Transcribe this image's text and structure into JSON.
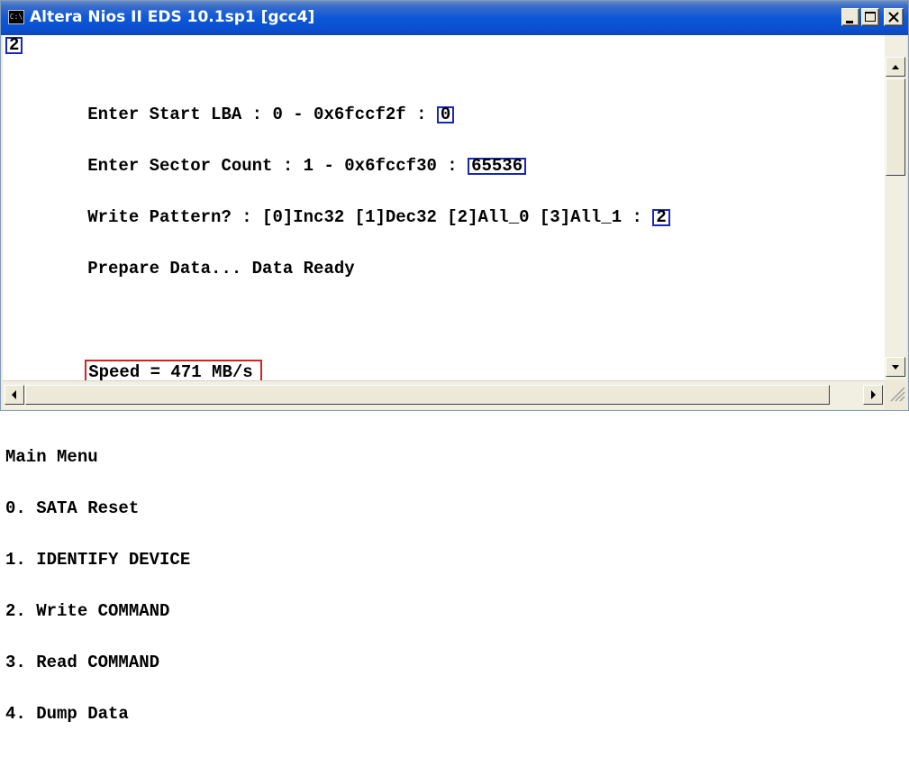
{
  "window": {
    "title": "Altera Nios II EDS 10.1sp1 [gcc4]",
    "icon_text": "C:\\",
    "title_bar_color": "#0a4fcf"
  },
  "console": {
    "first_input": "2",
    "lines": [
      {
        "prefix": "Enter Start LBA : 0 - 0x6fccf2f : ",
        "input": "0"
      },
      {
        "prefix": "Enter Sector Count : 1 - 0x6fccf30 : ",
        "input": "65536"
      },
      {
        "prefix": "Write Pattern? : [0]Inc32 [1]Dec32 [2]All_0 [3]All_1 : ",
        "input": "2"
      },
      {
        "text": "Prepare Data... Data Ready"
      }
    ],
    "speed": "Speed = 471 MB/s",
    "menu_title": "Main Menu",
    "menu_items": [
      "0. SATA Reset",
      "1. IDENTIFY DEVICE",
      "2. Write COMMAND",
      "3. Read COMMAND",
      "4. Dump Data"
    ],
    "highlight_blue": "#1728b8",
    "highlight_red": "#d42121"
  },
  "controls": {
    "minimize_icon": "minimize-icon",
    "maximize_icon": "maximize-icon",
    "close_icon": "close-icon"
  }
}
